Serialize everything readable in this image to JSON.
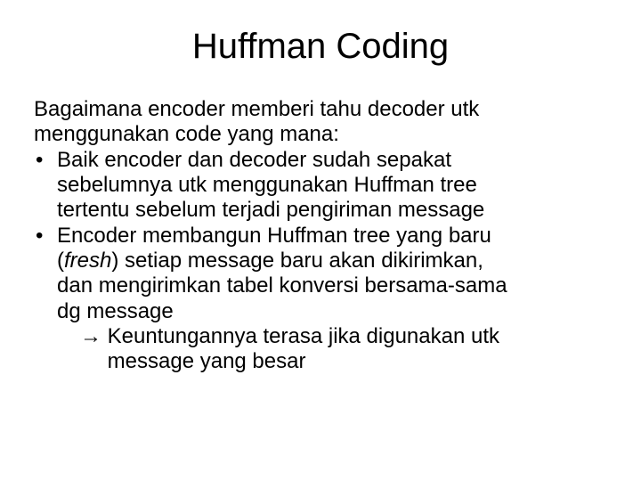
{
  "title": "Huffman Coding",
  "intro_line1": "Bagaimana encoder memberi tahu decoder utk",
  "intro_line2": "menggunakan code yang mana:",
  "bullets": [
    {
      "l1": "Baik encoder dan decoder sudah sepakat",
      "l2": "sebelumnya utk menggunakan Huffman tree",
      "l3": "tertentu sebelum terjadi pengiriman message"
    },
    {
      "l1": "Encoder membangun Huffman tree yang baru",
      "l2_a": "(",
      "l2_b": "fresh",
      "l2_c": ") setiap message baru akan dikirimkan,",
      "l3": "dan mengirimkan tabel konversi bersama-sama",
      "l4": "dg message"
    }
  ],
  "arrow": "→",
  "sub_l1": " Keuntungannya terasa jika digunakan utk",
  "sub_l2": "message yang besar"
}
